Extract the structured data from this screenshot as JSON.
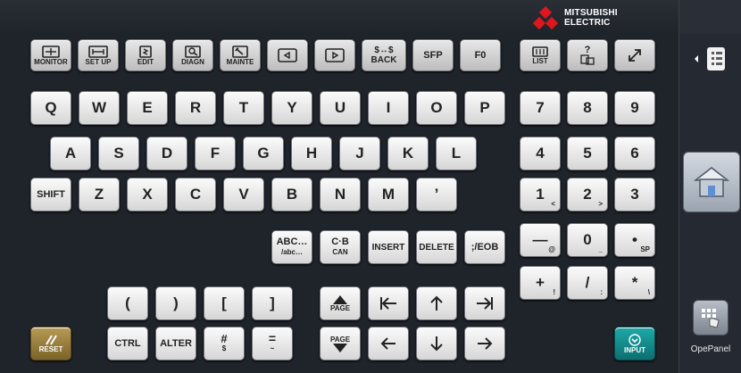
{
  "brand": {
    "line1": "MITSUBISHI",
    "line2": "ELECTRIC"
  },
  "function_keys": [
    {
      "id": "monitor",
      "label": "MONITOR",
      "icon": "monitor-icon"
    },
    {
      "id": "setup",
      "label": "SET UP",
      "icon": "setup-icon"
    },
    {
      "id": "edit",
      "label": "EDIT",
      "icon": "edit-icon"
    },
    {
      "id": "diagn",
      "label": "DIAGN",
      "icon": "diagnosis-icon"
    },
    {
      "id": "mainte",
      "label": "MAINTE",
      "icon": "maintenance-icon"
    },
    {
      "id": "prev",
      "label": "",
      "icon": "menu-back-icon"
    },
    {
      "id": "next",
      "label": "",
      "icon": "menu-forward-icon"
    },
    {
      "id": "back",
      "label": "$↔$\nBACK"
    },
    {
      "id": "sfp",
      "label": "SFP"
    },
    {
      "id": "f0",
      "label": "F0"
    },
    {
      "id": "list",
      "label": "LIST",
      "icon": "list-icon"
    },
    {
      "id": "help",
      "label": "?",
      "icon": "window-help-icon"
    },
    {
      "id": "resize",
      "label": "",
      "icon": "expand-arrow-icon"
    }
  ],
  "rows": {
    "row1": [
      "Q",
      "W",
      "E",
      "R",
      "T",
      "Y",
      "U",
      "I",
      "O",
      "P"
    ],
    "row2": [
      "A",
      "S",
      "D",
      "F",
      "G",
      "H",
      "J",
      "K",
      "L"
    ],
    "row3": [
      "Z",
      "X",
      "C",
      "V",
      "B",
      "N",
      "M",
      "’"
    ],
    "shift": "SHIFT"
  },
  "numpad": {
    "r1": [
      "7",
      "8",
      "9"
    ],
    "r2": [
      "4",
      "5",
      "6"
    ],
    "r3": [
      {
        "main": "1",
        "sub": "<"
      },
      {
        "main": "2",
        "sub": ">"
      },
      {
        "main": "3",
        "sub": ""
      }
    ],
    "r4": [
      {
        "main": "—",
        "sub": "@"
      },
      {
        "main": "0",
        "sub": "_"
      },
      {
        "main": "•",
        "sub": "SP"
      }
    ],
    "r5": [
      {
        "main": "+",
        "sub": "!"
      },
      {
        "main": "/",
        "sub": ":"
      },
      {
        "main": "*",
        "sub": "\\"
      }
    ]
  },
  "edit_keys": {
    "abc": {
      "main": "ABC…",
      "sub": "/abc…"
    },
    "cb_can": {
      "main": "C·B",
      "sub": "CAN"
    },
    "insert": "INSERT",
    "delete": "DELETE",
    "eob": ";/EOB"
  },
  "bracket_keys": [
    "(",
    ")",
    "[",
    "]"
  ],
  "bottom_keys": {
    "reset": "RESET",
    "ctrl": "CTRL",
    "alter": "ALTER",
    "hash": {
      "main": "#",
      "sub": "$"
    },
    "eq": {
      "main": "=",
      "sub": "~"
    },
    "input": "INPUT"
  },
  "cursor_keys": {
    "page_up": "PAGE",
    "page_down": "PAGE"
  },
  "side": {
    "opepanel_label": "OpePanel"
  },
  "colors": {
    "background": "#1f232a",
    "key_face": "#f0f0f0",
    "reset_key": "#9a7f3e",
    "input_key": "#16908f",
    "brand_red": "#e0161e"
  }
}
